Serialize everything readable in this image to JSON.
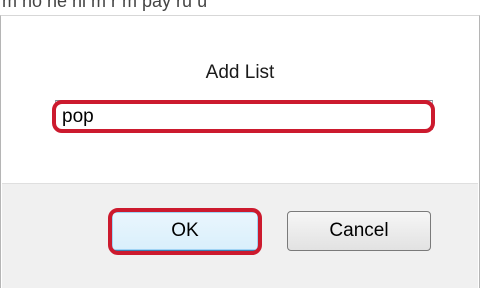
{
  "background_text": "m no ne nl  m  r  m  pay ru  u",
  "dialog": {
    "title": "Add List",
    "input": {
      "value": "pop"
    },
    "buttons": {
      "ok_label": "OK",
      "cancel_label": "Cancel"
    }
  },
  "colors": {
    "highlight": "#cc1a2e",
    "button_area_bg": "#f0f0f0",
    "default_button_border": "#3c7fb1"
  }
}
